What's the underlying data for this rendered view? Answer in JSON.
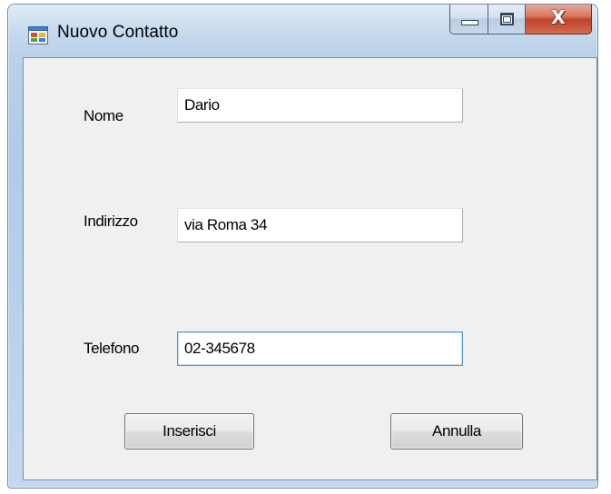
{
  "window": {
    "title": "Nuovo Contatto",
    "app_icon": "form-app-icon",
    "caption_buttons": {
      "minimize_icon": "minimize-icon",
      "maximize_icon": "maximize-icon",
      "close_icon": "close-icon",
      "close_glyph": "X"
    }
  },
  "form": {
    "nome_label": "Nome",
    "nome_value": "Dario",
    "indirizzo_label": "Indirizzo",
    "indirizzo_value": "via Roma 34",
    "telefono_label": "Telefono",
    "telefono_value": "02-345678",
    "focused_field": "telefono"
  },
  "buttons": {
    "insert_label": "Inserisci",
    "cancel_label": "Annulla"
  },
  "colors": {
    "close_button": "#c2432a",
    "focus_border": "#5799d1",
    "client_background": "#f0f0f0"
  }
}
